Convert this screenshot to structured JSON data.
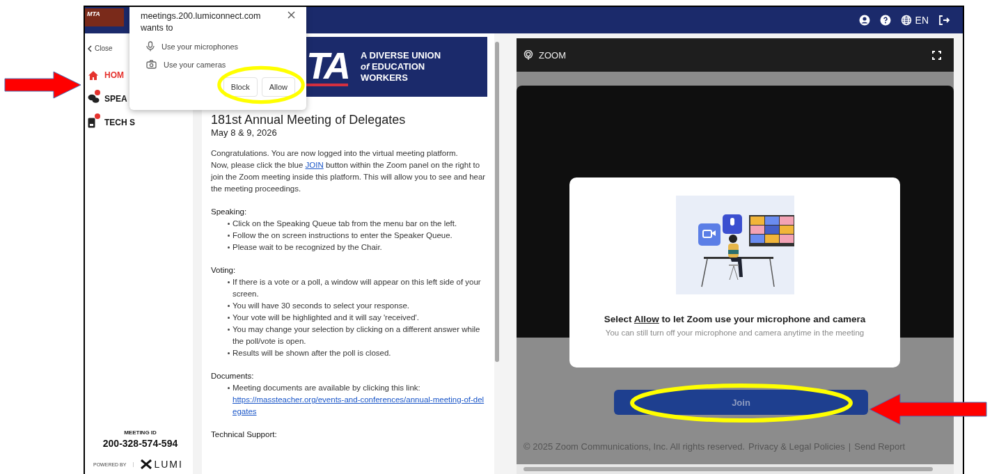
{
  "top_bar": {
    "logo": "MTA",
    "language": "EN"
  },
  "sidebar": {
    "close": "Close",
    "items": [
      {
        "kind": "home",
        "label": "HOM",
        "selected": true,
        "badge": false
      },
      {
        "kind": "chat",
        "label": "SPEA",
        "selected": false,
        "badge": true
      },
      {
        "kind": "device",
        "label": "TECH S",
        "selected": false,
        "badge": true
      }
    ],
    "meeting_id_label": "MEETING ID",
    "meeting_id": "200-328-574-594",
    "powered_by": "POWERED BY",
    "brand": "LUMI"
  },
  "permission_popup": {
    "origin": "meetings.200.lumiconnect.com",
    "prompt": "wants to",
    "permissions": [
      {
        "kind": "microphone",
        "label": "Use your microphones"
      },
      {
        "kind": "camera",
        "label": "Use your cameras"
      }
    ],
    "buttons": [
      "Block",
      "Allow"
    ]
  },
  "content": {
    "banner": {
      "logo": "TA",
      "tagline": [
        "A DIVERSE UNION",
        "*of* EDUCATION",
        "WORKERS"
      ]
    },
    "title": "181st Annual Meeting of Delegates",
    "date": "May 8 & 9, 2026",
    "intro": "Congratulations. You are now logged into the virtual meeting platform.",
    "instruction": {
      "before": "Now, please click the blue ",
      "link": "JOIN",
      "after": " button within the Zoom panel on the right to join the Zoom meeting inside this platform. This will allow you to see and hear the meeting proceedings."
    },
    "sections": [
      {
        "heading": "Speaking:",
        "bullets": [
          {
            "text": "Click on the Speaking Queue tab from the menu bar on the left."
          },
          {
            "text": "Follow the on screen instructions to enter the Speaker Queue."
          },
          {
            "text": "Please wait to be recognized by the Chair."
          }
        ]
      },
      {
        "heading": "Voting:",
        "bullets": [
          {
            "text": "If there is a vote or a poll, a window will appear on this left side of your screen."
          },
          {
            "text": "You will have 30 seconds to select your response."
          },
          {
            "text": "Your vote will be highlighted and it will say 'received'."
          },
          {
            "text": "You may change your selection by clicking on a different answer while the poll/vote is open."
          },
          {
            "text": "Results will be shown after the poll is closed."
          }
        ]
      },
      {
        "heading": "Documents:",
        "bullets": [
          {
            "text": "Meeting documents are available by clicking this link:",
            "link": "https://massteacher.org/events-and-conferences/annual-meeting-of-delegates"
          }
        ]
      },
      {
        "heading": "Technical Support:"
      }
    ]
  },
  "zoom_panel": {
    "title": "ZOOM",
    "prompt": {
      "before": "Select ",
      "link": "Allow",
      "after": " to let Zoom use your microphone and camera"
    },
    "note": "You can still turn off your microphone and camera anytime in the meeting",
    "join": {
      "label": "Join",
      "disabled": true
    },
    "footer": "© 2025 Zoom Communications, Inc. All rights reserved.",
    "footer_link": "Privacy & Legal Policies",
    "separator": "|",
    "report": "Send Report"
  }
}
